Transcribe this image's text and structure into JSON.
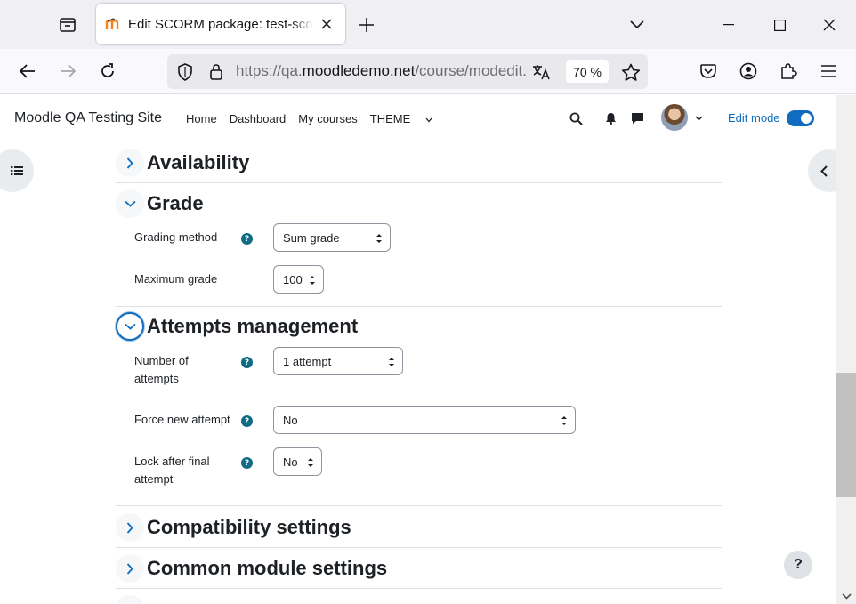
{
  "browser": {
    "tab_title": "Edit SCORM package: test-scorm",
    "url_prefix": "https://qa.",
    "url_host": "moodledemo.net",
    "url_suffix": "/course/modedit.php",
    "zoom": "70 %"
  },
  "site": {
    "name": "Moodle QA Testing Site",
    "nav": {
      "home": "Home",
      "dashboard": "Dashboard",
      "my_courses": "My courses",
      "theme": "THEME"
    },
    "edit_mode_label": "Edit mode",
    "edit_mode_on": true
  },
  "sections": {
    "availability": {
      "title": "Availability"
    },
    "grade": {
      "title": "Grade",
      "grading_method": {
        "label": "Grading method",
        "value": "Sum grade"
      },
      "maximum_grade": {
        "label": "Maximum grade",
        "value": "100"
      }
    },
    "attempts": {
      "title": "Attempts management",
      "number_of_attempts": {
        "label": "Number of attempts",
        "value": "1 attempt"
      },
      "force_new_attempt": {
        "label": "Force new attempt",
        "value": "No"
      },
      "lock_after_final": {
        "label": "Lock after final attempt",
        "value": "No"
      }
    },
    "compatibility": {
      "title": "Compatibility settings"
    },
    "common_module": {
      "title": "Common module settings"
    }
  },
  "help_fab": "?",
  "colors": {
    "brand": "#0f6cbf",
    "help_icon": "#0f6c84"
  }
}
